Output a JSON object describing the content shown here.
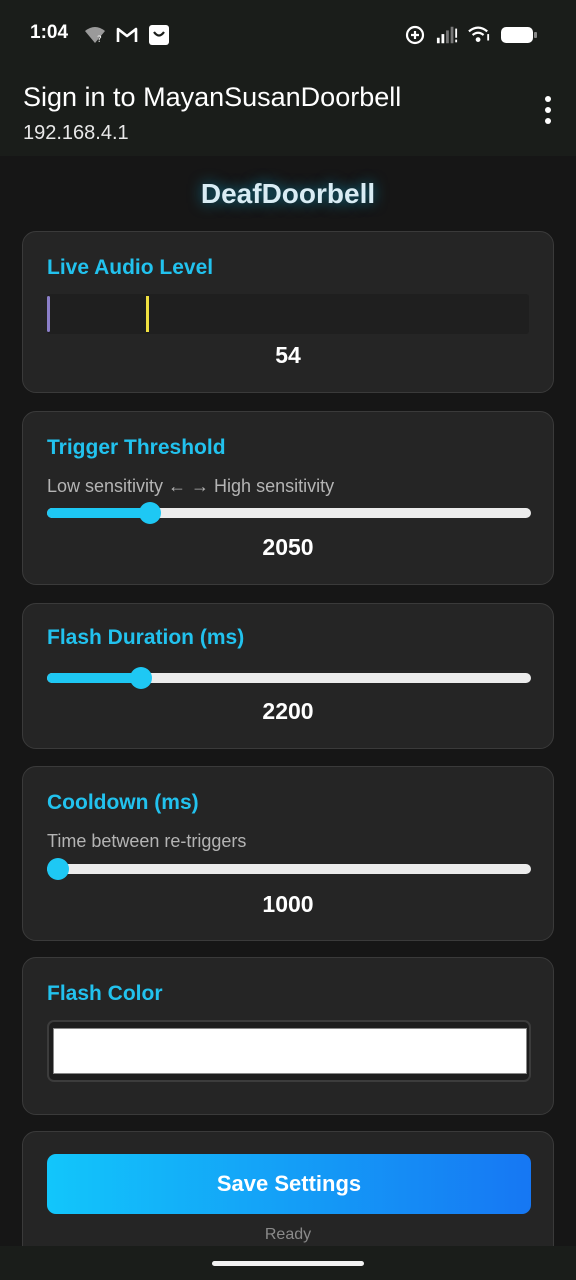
{
  "status_bar": {
    "time": "1:04",
    "left_icons": [
      "wifi-question-icon",
      "gmail-icon",
      "shopping-bag-icon"
    ],
    "right_icons": [
      "data-saver-icon",
      "signal-icon",
      "wifi-icon",
      "battery-icon"
    ]
  },
  "app_bar": {
    "title": "Sign in to MayanSusanDoorbell",
    "subtitle": "192.168.4.1",
    "menu_icon": "more-vert-icon"
  },
  "page": {
    "heading": "DeafDoorbell"
  },
  "audio_level": {
    "title": "Live Audio Level",
    "value": "54",
    "peak_fraction": 0.205
  },
  "trigger_threshold": {
    "title": "Trigger Threshold",
    "description": "Low sensitivity ← → High sensitivity",
    "value": "2050",
    "level_fraction": 0.212
  },
  "flash_duration": {
    "title": "Flash Duration (ms)",
    "value": "2200",
    "level_fraction": 0.194
  },
  "cooldown": {
    "title": "Cooldown (ms)",
    "description": "Time between re-triggers",
    "value": "1000",
    "level_fraction": 0.0
  },
  "flash_color": {
    "title": "Flash Color",
    "color": "#ffffff"
  },
  "save": {
    "button_label": "Save Settings",
    "status": "Ready"
  },
  "colors": {
    "accent": "#22c2ee",
    "button_start": "#12c6fb",
    "button_end": "#1677f3",
    "peak_marker": "#f0e040"
  }
}
